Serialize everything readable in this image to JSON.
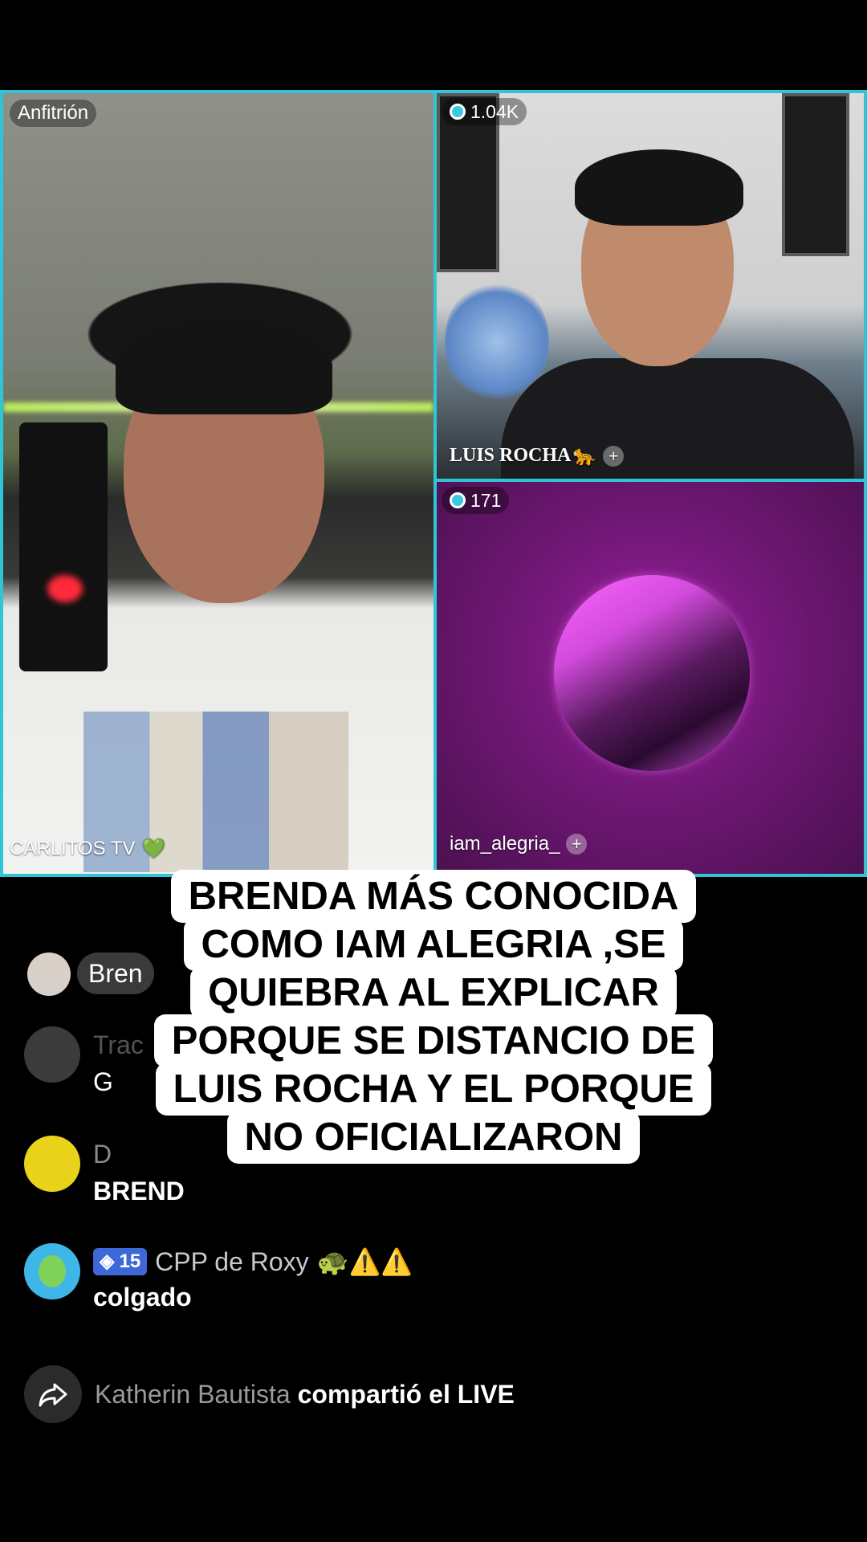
{
  "participants": {
    "host": {
      "badge": "Anfitrión",
      "name": "CARLITOS TV",
      "emoji": "💚"
    },
    "guest1": {
      "viewers": "1.04K",
      "name": "LUIS ROCHA",
      "emoji": "🐆",
      "add": "+"
    },
    "guest2": {
      "viewers": "171",
      "name": "iam_alegria_",
      "add": "+"
    }
  },
  "caption": {
    "lines": [
      "BRENDA MÁS CONOCIDA",
      "COMO IAM ALEGRIA ,SE",
      "QUIEBRA AL EXPLICAR",
      "PORQUE SE DISTANCIO DE",
      "LUIS ROCHA Y EL PORQUE",
      "NO OFICIALIZARON"
    ]
  },
  "comments": [
    {
      "user": "Bren",
      "text": ""
    },
    {
      "user": "Trac",
      "text": "G"
    },
    {
      "user": "D",
      "text": "BREND"
    },
    {
      "level": "15",
      "user": "CPP de Roxy",
      "emojis": "🐢⚠️⚠️",
      "text": "colgado"
    }
  ],
  "share": {
    "user": "Katherin Bautista",
    "action": "compartió el LIVE"
  },
  "colors": {
    "accent": "#2ec6d6",
    "badge": "#3e67d8"
  }
}
